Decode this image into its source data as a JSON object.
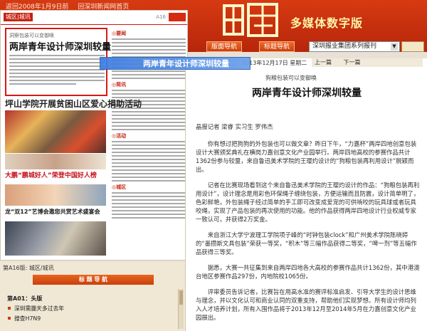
{
  "header": {
    "top_links": [
      "返回2008年1月9日前",
      "回深圳新闻网首页"
    ],
    "brand_title": "多媒体数字版",
    "nav_buttons": [
      "版面导航",
      "标题导航"
    ],
    "publication_select": "深圳报业集团系列报刊"
  },
  "newspaper_page": {
    "section_tag": "城区|城讯",
    "lede_kicker": "洞察包装可以变御唤",
    "lede_headline": "两岸青年设计师深圳较量",
    "headline_2": "坪山学院开展贫困山区爱心捐助活动",
    "headline_3": "大鹏“鹏城好人”荣登中国好人榜",
    "headline_4": "龙“双12”艺博会邀您共赏艺术盛宴会",
    "right_col_heads": [
      "◎要闻",
      "◎简讯",
      "◎活动",
      "◎城区"
    ]
  },
  "tooltip": {
    "text": "两岸青年设计师深圳较量"
  },
  "article": {
    "date": "2013年12月17日 星期二",
    "pager": [
      "上一篇",
      "下一篇"
    ],
    "kicker": "狗粮包装可以变御唤",
    "title": "两岸青年设计师深圳较量",
    "byline": "晶报记者 梁睿 实习生 罗伟杰",
    "paragraphs": [
      "你有想过把狗狗的外包装也可以做文章？昨日下午，“力嘉杯”两岸四地创意包装设计大赛颁奖典礼在横岗力嘉创意文化产业园举行。两岸四地高校的参赛作品共计1362份参与较量，来自鲁迅美术学院的王璎灼设计的“狗粮包装再利用设计”脱颖而出。",
      "记者在比赛现场看到这个来自鲁迅美术学院的王璎灼设计的作品：“狗粮包装再利用设计”，设计理念是用彩色环保绳子缠绕包装，方便运输而且防震，设计简单明了，色彩鲜艳，外包装绳子经过简单的手工即可改变成爱宠的可供啃咬的玩具球或者玩具咬绳，实现了产品包装的再次使用的功能。他的作品获得两岸四地设计行业权威专家一致认可，并获得2万奖金。",
      "来自浙江大学宁波理工学院项子峰的“时钟包装clock”和广州美术学院陈晓婷的“墨攒斯文具包装”荣获一等奖，“积木”等三幅作品获得二等奖，“啤一剂”等五幅作品获得三等奖。",
      "据悉，大赛一共征集到来自两岸四地各大高校的参赛作品共计1362份，其中港澳台地区参赛作品297份，内地院校1065份。",
      "评审委员告诉记者，比赛旨在用高水准的赛评标准启发、引导大学生的设计思维与理念，并以文化认可和商业认同的双重支持，帮助他们实现梦想。所有设计师均列入人才培养计划，所有入围作品将于2013年12月至2014年5月在力嘉创意文化产业园展出。"
    ]
  },
  "bottom_nav": {
    "breadcrumb": "第A16版: 城区/城讯",
    "title": "标 题 导 航",
    "page_head": "第A01：头版",
    "items": [
      "深圳需霾天多过去年",
      "搜查H7N9"
    ]
  }
}
